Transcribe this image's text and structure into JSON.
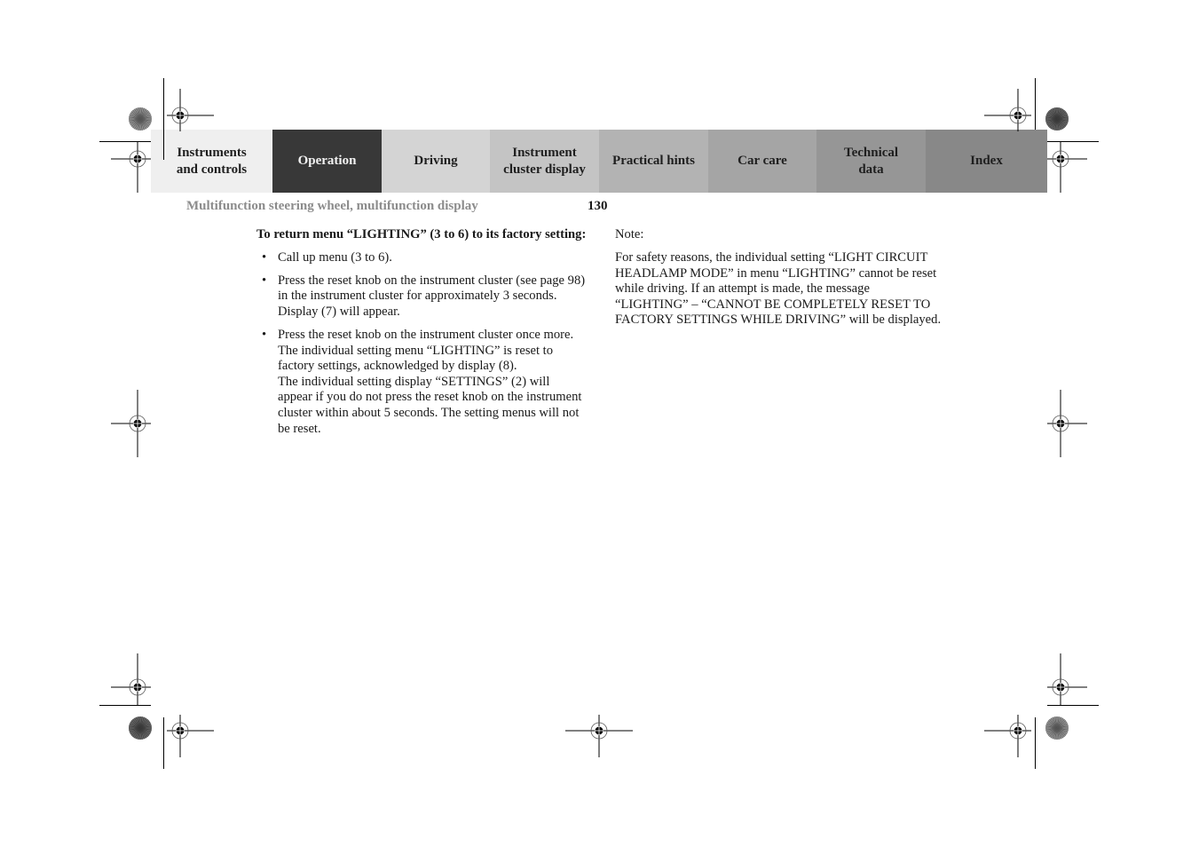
{
  "nav": {
    "tabs": [
      {
        "label": "Instruments and controls",
        "lines": [
          "Instruments",
          "and controls"
        ],
        "bg": "#efefef",
        "active": false
      },
      {
        "label": "Operation",
        "lines": [
          "Operation"
        ],
        "bg": "#383838",
        "active": true
      },
      {
        "label": "Driving",
        "lines": [
          "Driving"
        ],
        "bg": "#d4d4d4",
        "active": false
      },
      {
        "label": "Instrument cluster display",
        "lines": [
          "Instrument",
          "cluster display"
        ],
        "bg": "#c4c4c4",
        "active": false
      },
      {
        "label": "Practical hints",
        "lines": [
          "Practical hints"
        ],
        "bg": "#b3b3b3",
        "active": false
      },
      {
        "label": "Car care",
        "lines": [
          "Car care"
        ],
        "bg": "#a5a5a5",
        "active": false
      },
      {
        "label": "Technical data",
        "lines": [
          "Technical",
          "data"
        ],
        "bg": "#969696",
        "active": false
      },
      {
        "label": "Index",
        "lines": [
          "Index"
        ],
        "bg": "#888888",
        "active": false
      }
    ]
  },
  "header": {
    "section_title": "Multifunction steering wheel, multifunction display",
    "page_number": "130"
  },
  "left_column": {
    "heading": "To return menu “LIGHTING” (3 to 6) to its factory setting:",
    "steps": [
      {
        "bullet": "•",
        "text": "Call up menu (3 to 6)."
      },
      {
        "bullet": "•",
        "text": "Press the reset knob on the instrument cluster (see page 98) in the instrument cluster for approximately 3 seconds. Display (7) will appear."
      },
      {
        "bullet": "•",
        "text": "Press the reset knob on the instrument cluster once more. The individual setting menu “LIGHTING” is reset to factory settings, acknowledged by display (8).",
        "continuation": "The individual setting display “SETTINGS” (2) will appear if you do not press the reset knob on the instrument cluster within about 5 seconds. The setting menus will not be reset."
      }
    ]
  },
  "right_column": {
    "note_label": "Note:",
    "note_text": "For safety reasons, the individual setting “LIGHT CIRCUIT HEADLAMP MODE” in menu “LIGHTING” cannot be reset while driving. If an attempt is made, the message “LIGHTING” – “CANNOT BE COMPLETELY RESET TO FACTORY SETTINGS WHILE DRIVING” will be displayed."
  },
  "print_marks": {
    "registration_icon": "crosshair-registration-icon",
    "color_bar_icon": "star-target-icon"
  }
}
